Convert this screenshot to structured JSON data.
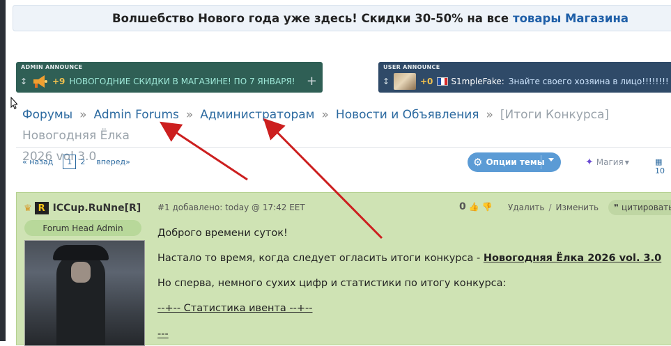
{
  "banner": {
    "text": "Волшебство Нового года уже здесь! Скидки 30-50% на все",
    "link": "товары Магазина"
  },
  "admin_announce": {
    "header": "ADMIN ANNOUNCE",
    "count": "+9",
    "text": "НОВОГОДНИЕ СКИДКИ В МАГАЗИНЕ! ПО 7 ЯНВАРЯ!",
    "add": "+"
  },
  "user_announce": {
    "header": "USER ANNOUNCE",
    "count": "+0",
    "username": "S1mpleFake:",
    "text": "Знайте своего хозяина в лицо!!!!!!!!"
  },
  "breadcrumb": {
    "items": [
      "Форумы",
      "Admin Forums",
      "Администраторам",
      "Новости и Объявления"
    ],
    "sep": "»",
    "current": "[Итоги Конкурса] Новогодняя Ёлка",
    "current_line2": "2026 vol 3.0"
  },
  "pager": {
    "prev": "« назад",
    "pages": [
      "1",
      "2"
    ],
    "next": "вперед»"
  },
  "toolbar": {
    "options_label": "Опции темы",
    "magic_label": "Магия",
    "count": "10"
  },
  "post": {
    "author": "ICCup.RuNne[R]",
    "role": "Forum Head Admin",
    "meta": "#1 добавлено: today @ 17:42 EET",
    "rating": "0",
    "delete": "Удалить",
    "slash": "/",
    "edit": "Изменить",
    "quote": "цитировать",
    "lines": {
      "greeting": "Доброго времени суток!",
      "intro": "Настало то время, когда следует огласить итоги конкурса -",
      "intro_link": "Новогодняя Ёлка 2026 vol. 3.0",
      "stats_intro": "Но сперва, немного сухих цифр и статистики по итогу конкурса:",
      "stats_header": "--+-- Статистика ивента --+--",
      "dashes": "---"
    }
  },
  "colors": {
    "arrow": "#cc1f1f",
    "post_bg": "#cfe3b4",
    "link": "#2c6aa0"
  }
}
